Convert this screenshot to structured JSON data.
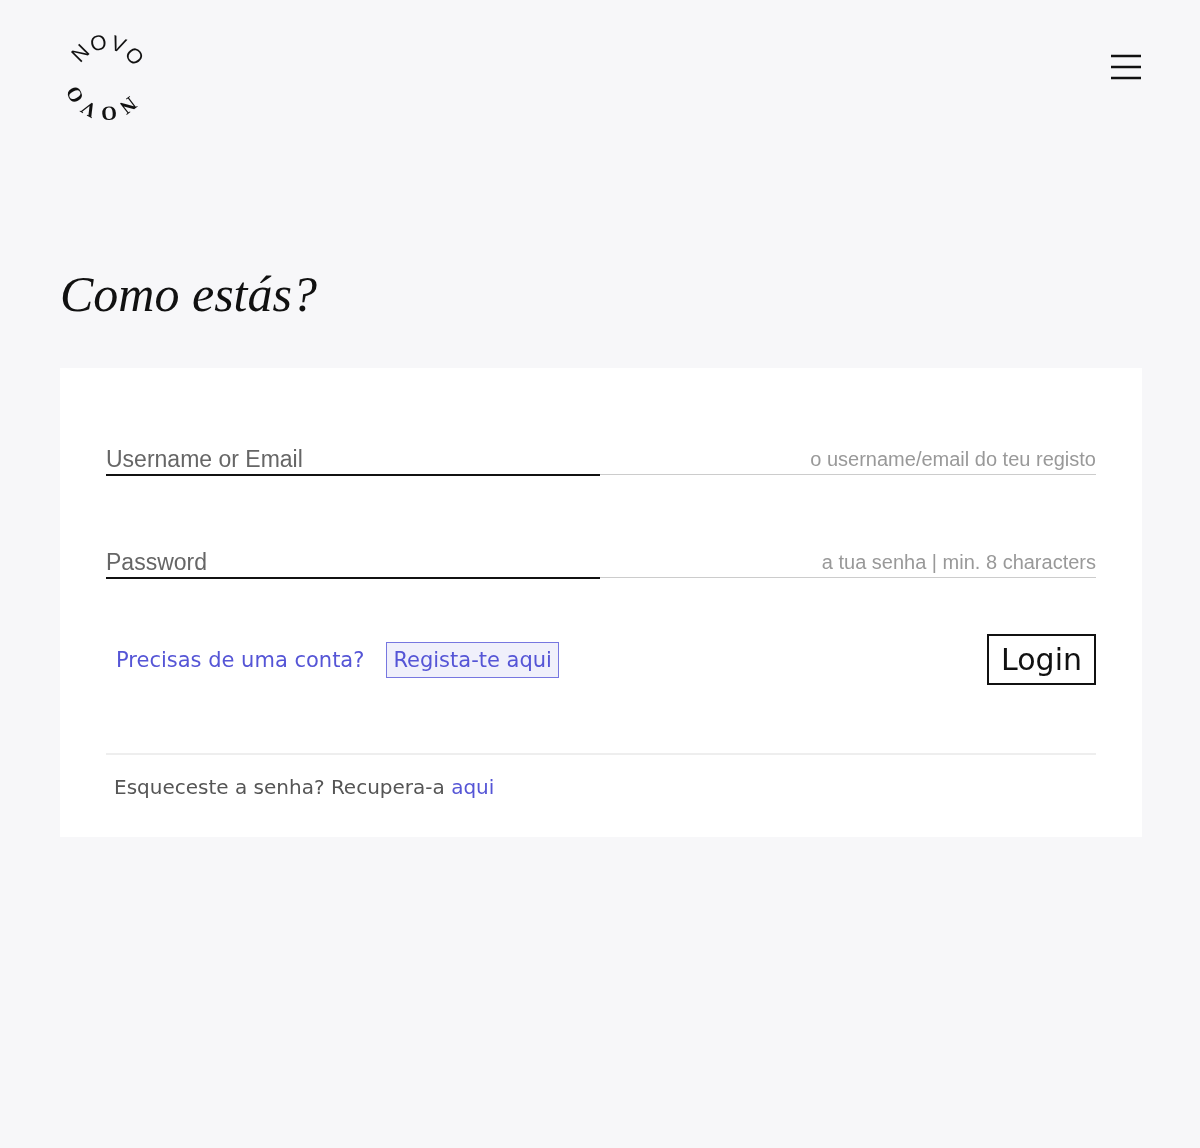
{
  "logo": {
    "top": "NOVO",
    "bottom": "NOVO"
  },
  "heading": "Como estás?",
  "fields": [
    {
      "label": "Username or Email",
      "placeholder": "o username/email do teu registo"
    },
    {
      "label": "Password",
      "placeholder": "a tua senha | min. 8 characters"
    }
  ],
  "signup": {
    "prompt": "Precisas de uma conta?",
    "link": "Regista-te aqui"
  },
  "login_button": "Login",
  "forgot": {
    "text": "Esqueceste a senha? Recupera-a",
    "link": "aqui"
  }
}
